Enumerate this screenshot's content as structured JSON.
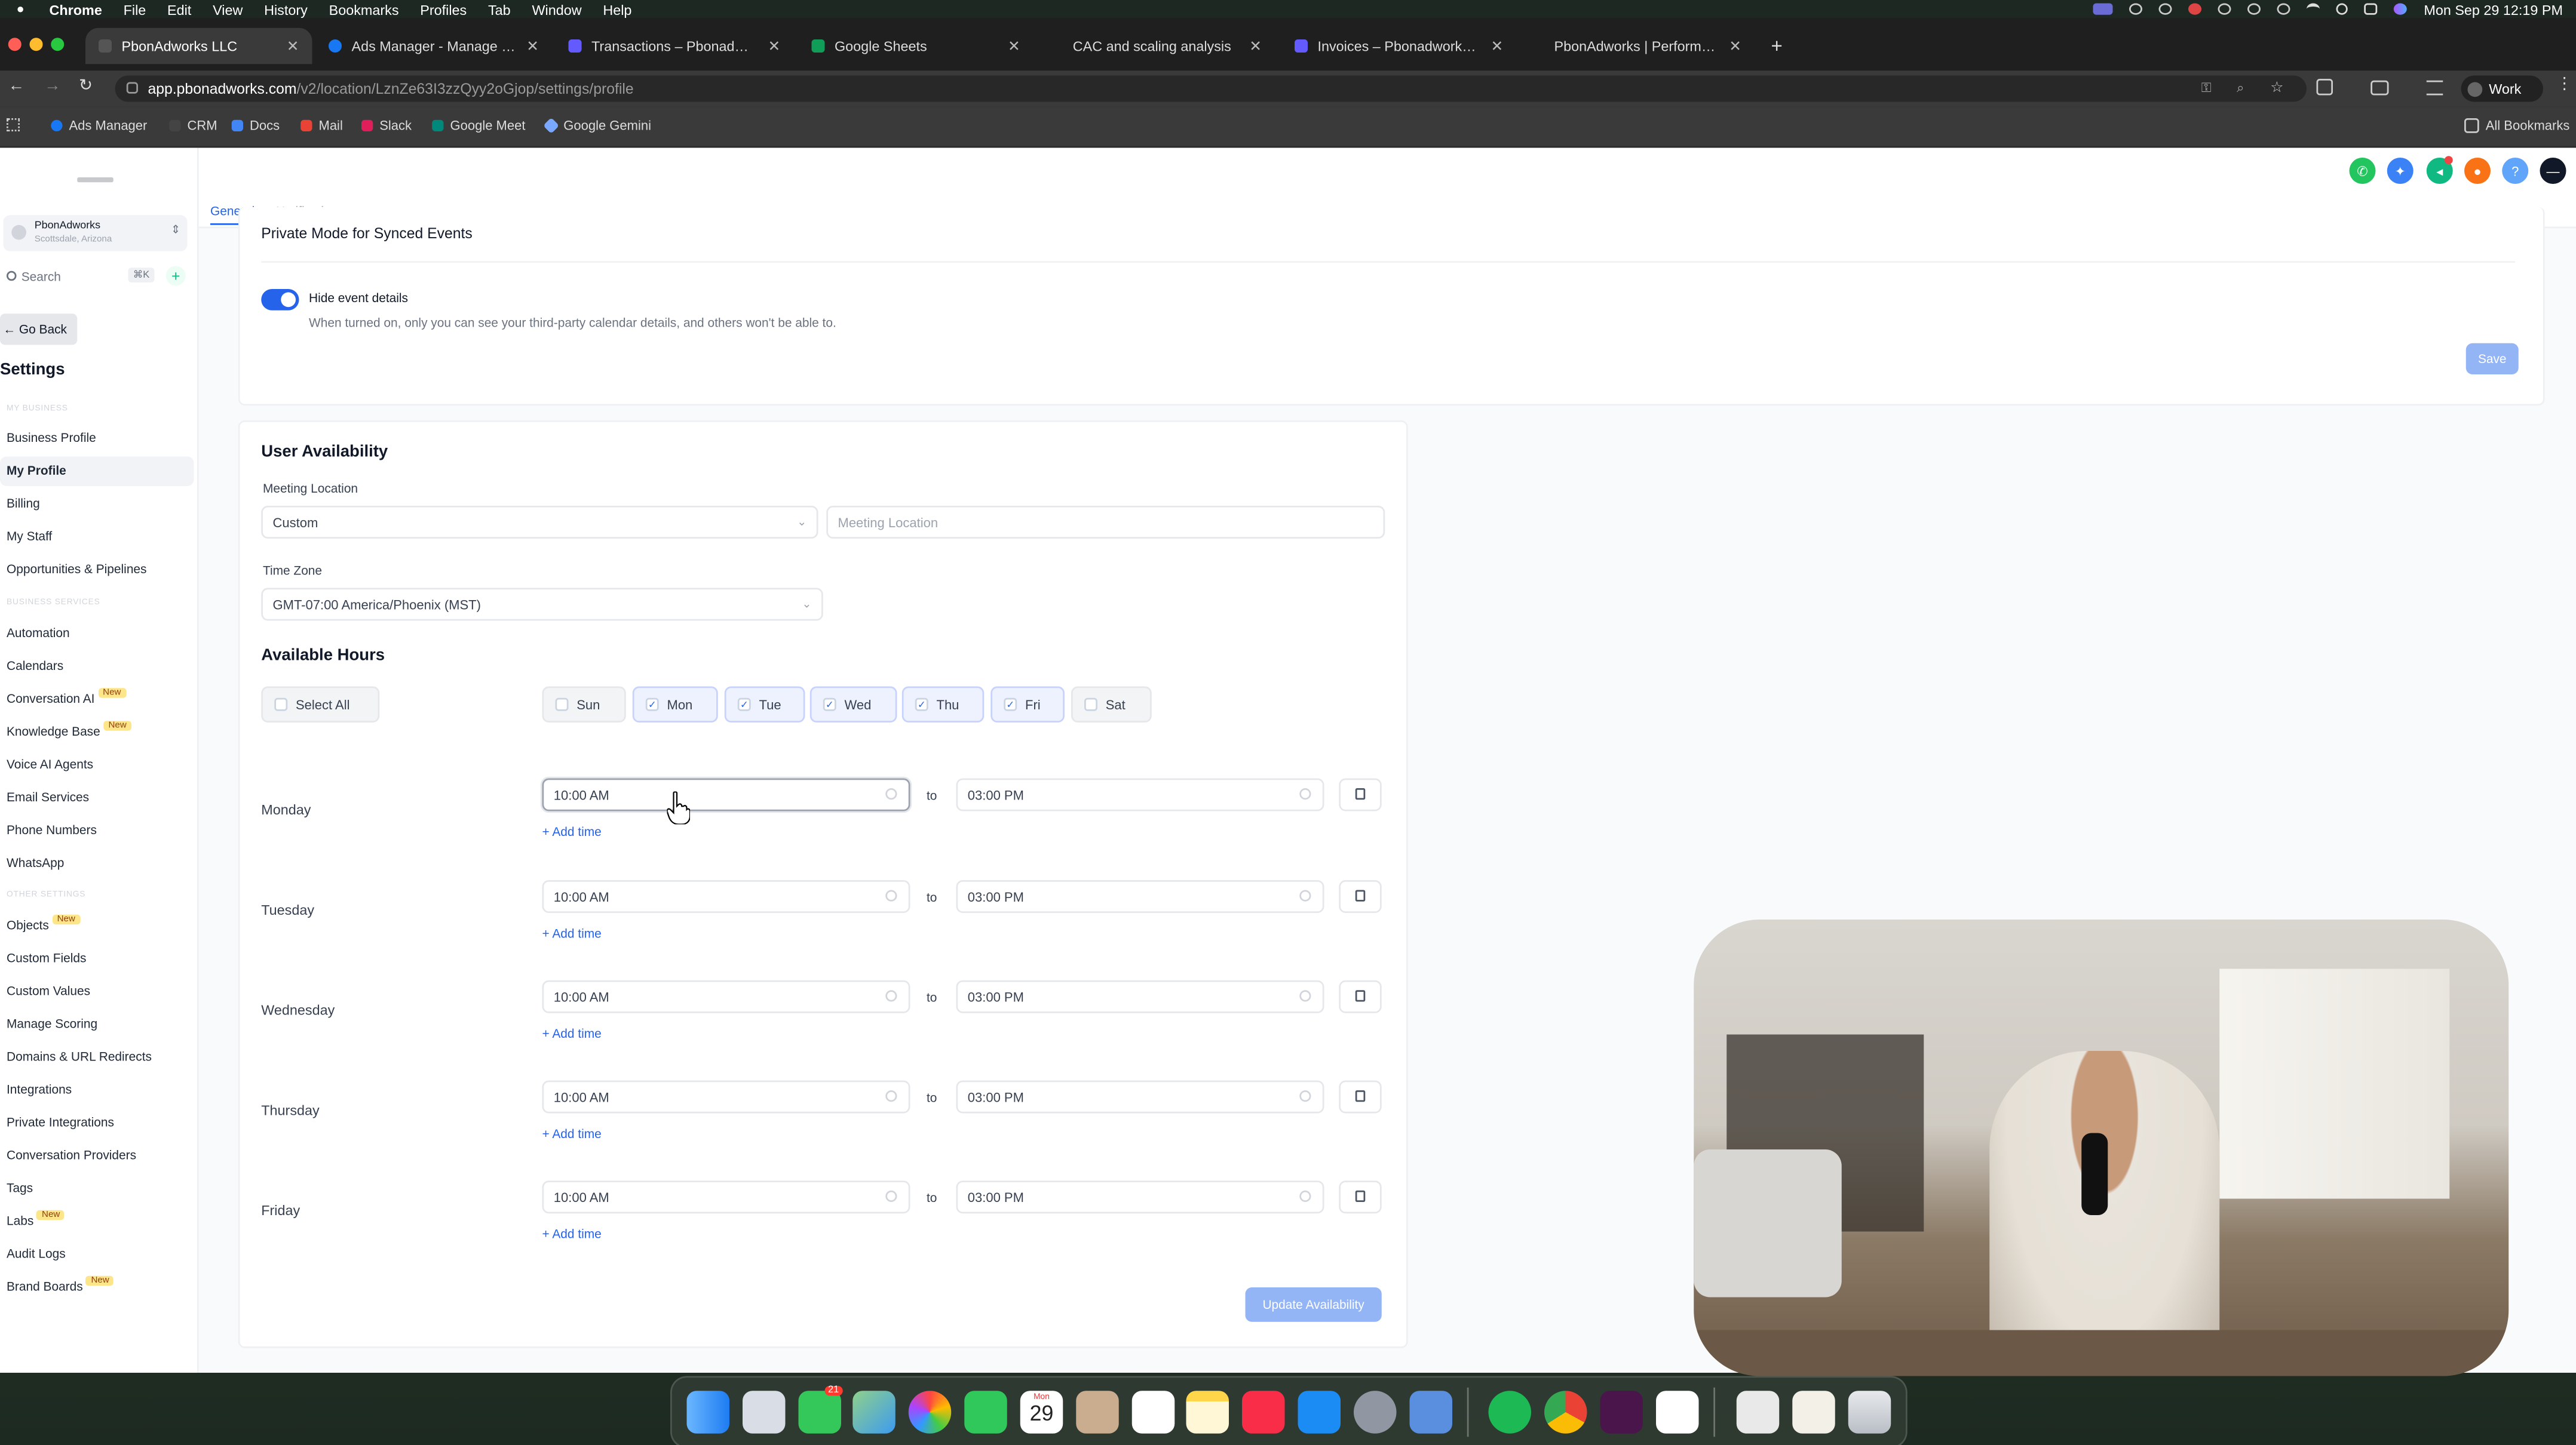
{
  "menubar": {
    "app": "Chrome",
    "items": [
      "File",
      "Edit",
      "View",
      "History",
      "Bookmarks",
      "Profiles",
      "Tab",
      "Window",
      "Help"
    ],
    "clock": "Mon Sep 29  12:19 PM"
  },
  "tabs": [
    {
      "label": "PbonAdworks LLC",
      "favicon_color": "#3a3a3a"
    },
    {
      "label": "Ads Manager - Manage ads",
      "favicon_color": "#1877f2"
    },
    {
      "label": "Transactions – Pbonadworks",
      "favicon_color": "#635bff"
    },
    {
      "label": "Google Sheets",
      "favicon_color": "#0f9d58"
    },
    {
      "label": "CAC and scaling analysis",
      "favicon_color": "#1f1f1f"
    },
    {
      "label": "Invoices – Pbonadworks – St",
      "favicon_color": "#635bff"
    },
    {
      "label": "PbonAdworks | Performance",
      "favicon_color": "#1f1f1f"
    }
  ],
  "browser": {
    "url_host": "app.pbonadworks.com",
    "url_path": "/v2/location/LznZe63I3zzQyy2oGjop/settings/profile",
    "profile": "Work",
    "all_bookmarks": "All Bookmarks"
  },
  "bookmarks": [
    "Ads Manager",
    "CRM",
    "Docs",
    "Mail",
    "Slack",
    "Google Meet",
    "Google Gemini"
  ],
  "sidebar": {
    "account_name": "PbonAdworks",
    "account_location": "Scottsdale, Arizona",
    "search_placeholder": "Search",
    "search_shortcut": "⌘K",
    "go_back": "Go Back",
    "title": "Settings",
    "sections": {
      "my_business": "MY BUSINESS",
      "business_services": "BUSINESS SERVICES",
      "other_settings": "OTHER SETTINGS"
    },
    "items_business": [
      "Business Profile",
      "My Profile",
      "Billing",
      "My Staff",
      "Opportunities & Pipelines"
    ],
    "items_services": [
      "Automation",
      "Calendars",
      "Conversation AI",
      "Knowledge Base",
      "Voice AI Agents",
      "Email Services",
      "Phone Numbers",
      "WhatsApp"
    ],
    "items_other": [
      "Objects",
      "Custom Fields",
      "Custom Values",
      "Manage Scoring",
      "Domains & URL Redirects",
      "Integrations",
      "Private Integrations",
      "Conversation Providers",
      "Tags",
      "Labs",
      "Audit Logs",
      "Brand Boards"
    ],
    "new_badge": "New"
  },
  "topnav": {
    "tabs": [
      "General",
      "Notifications"
    ]
  },
  "private_mode": {
    "title": "Private Mode for Synced Events",
    "toggle_label": "Hide event details",
    "toggle_on": true,
    "help": "When turned on, only you can see your third-party calendar details, and others won't be able to.",
    "save": "Save"
  },
  "availability": {
    "title": "User Availability",
    "meeting_location_label": "Meeting Location",
    "meeting_location_value": "Custom",
    "meeting_location_placeholder": "Meeting Location",
    "timezone_label": "Time Zone",
    "timezone_value": "GMT-07:00 America/Phoenix (MST)",
    "hours_title": "Available Hours",
    "select_all": "Select All",
    "days": [
      {
        "short": "Sun",
        "checked": false
      },
      {
        "short": "Mon",
        "checked": true
      },
      {
        "short": "Tue",
        "checked": true
      },
      {
        "short": "Wed",
        "checked": true
      },
      {
        "short": "Thu",
        "checked": true
      },
      {
        "short": "Fri",
        "checked": true
      },
      {
        "short": "Sat",
        "checked": false
      }
    ],
    "to": "to",
    "add_time": "+ Add time",
    "schedule": [
      {
        "day": "Monday",
        "start": "10:00 AM",
        "end": "03:00 PM"
      },
      {
        "day": "Tuesday",
        "start": "10:00 AM",
        "end": "03:00 PM"
      },
      {
        "day": "Wednesday",
        "start": "10:00 AM",
        "end": "03:00 PM"
      },
      {
        "day": "Thursday",
        "start": "10:00 AM",
        "end": "03:00 PM"
      },
      {
        "day": "Friday",
        "start": "10:00 AM",
        "end": "03:00 PM"
      }
    ],
    "update_button": "Update Availability"
  },
  "dock": {
    "calendar_month": "Mon",
    "calendar_day": "29",
    "messages_badge": "21"
  }
}
